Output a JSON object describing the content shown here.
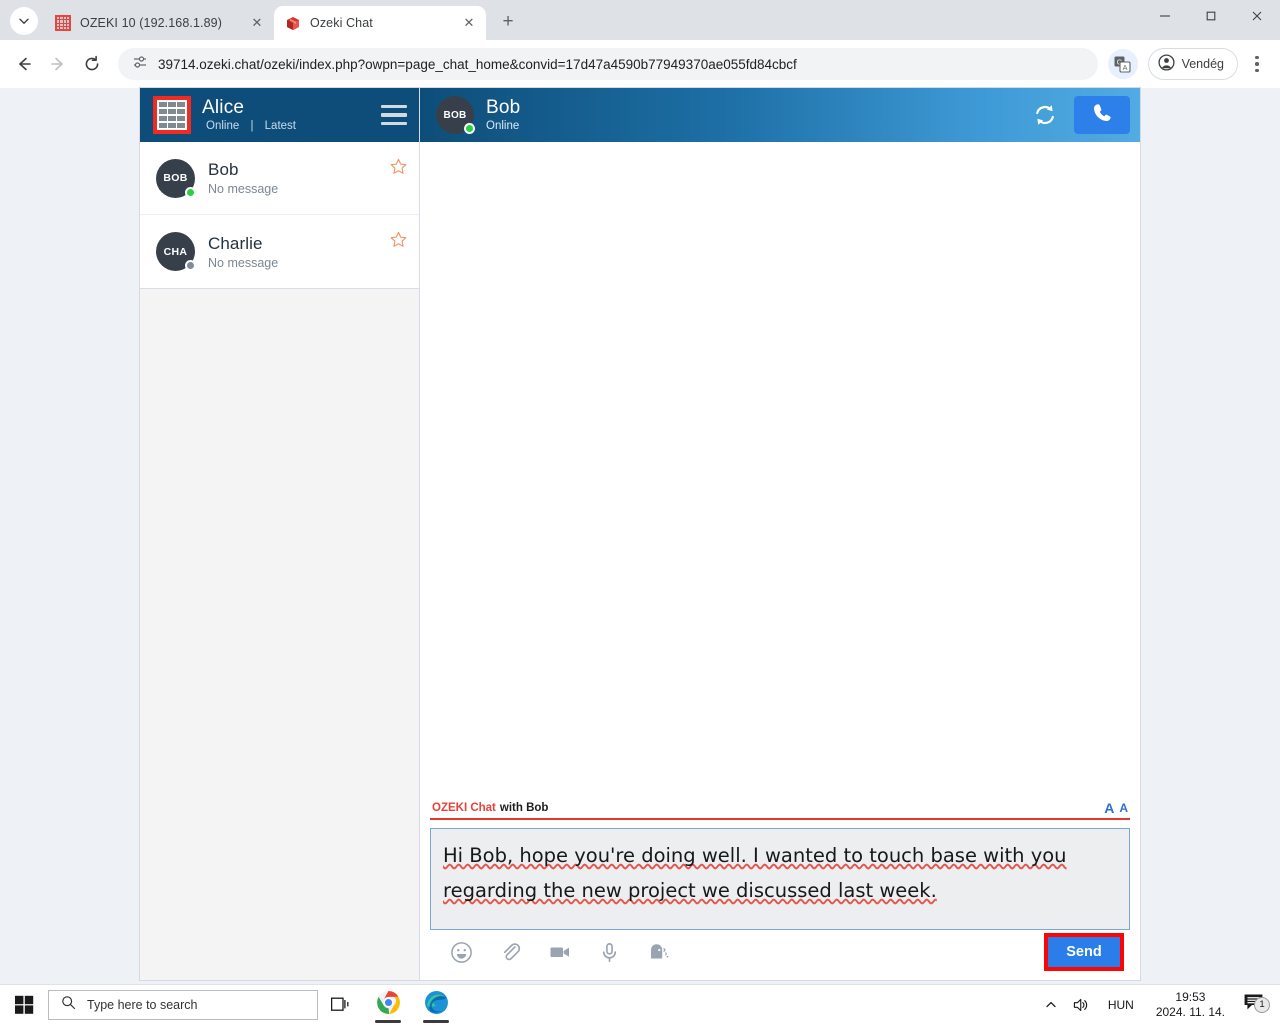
{
  "browser": {
    "tabs": [
      {
        "title": "OZEKI 10 (192.168.1.89)",
        "favicon": "ozeki10-grid-icon",
        "active": false
      },
      {
        "title": "Ozeki Chat",
        "favicon": "ozeki-cube-icon",
        "active": true
      }
    ],
    "new_tab_label": "+",
    "close_label": "✕",
    "address": "39714.ozeki.chat/ozeki/index.php?owpn=page_chat_home&convid=17d47a4590b77949370ae055fd84cbcf",
    "profile_label": "Vendég",
    "window_controls": {
      "minimize": "—",
      "maximize": "❐",
      "close": "✕"
    }
  },
  "sidebar": {
    "user": {
      "name": "Alice",
      "status": "Online",
      "separator": "|",
      "filter": "Latest"
    },
    "contacts": [
      {
        "name": "Bob",
        "initials": "BOB",
        "preview": "No message",
        "presence": "online",
        "favorite_icon": "star-icon"
      },
      {
        "name": "Charlie",
        "initials": "CHA",
        "preview": "No message",
        "presence": "offline",
        "favorite_icon": "star-icon"
      }
    ]
  },
  "chat": {
    "header": {
      "name": "Bob",
      "initials": "BOB",
      "status": "Online",
      "refresh_icon": "refresh-icon",
      "call_icon": "phone-icon"
    },
    "composer": {
      "brand": "OZEKI Chat",
      "with": "with Bob",
      "font_size_large": "A",
      "font_size_small": "A",
      "message": "Hi Bob, hope you're doing well. I wanted to touch base with you regarding the new project we discussed last week.",
      "placeholder": "",
      "toolbar_icons": [
        "emoji-icon",
        "attachment-icon",
        "video-icon",
        "microphone-icon",
        "text-to-speech-icon"
      ],
      "send_label": "Send"
    }
  },
  "taskbar": {
    "search_placeholder": "Type here to search",
    "language": "HUN",
    "time": "19:53",
    "date": "2024. 11. 14.",
    "notification_count": "1",
    "apps": [
      "chrome-icon",
      "edge-icon"
    ]
  },
  "colors": {
    "sidebar_header": "#0e4d79",
    "chat_header_start": "#0e4d79",
    "chat_header_end": "#52abe2",
    "accent_blue": "#2b7de9",
    "brand_red": "#e8403a",
    "highlight_red": "#fb0505",
    "star_orange": "#f59161",
    "online_green": "#27d045",
    "offline_gray": "#7f8b95"
  }
}
